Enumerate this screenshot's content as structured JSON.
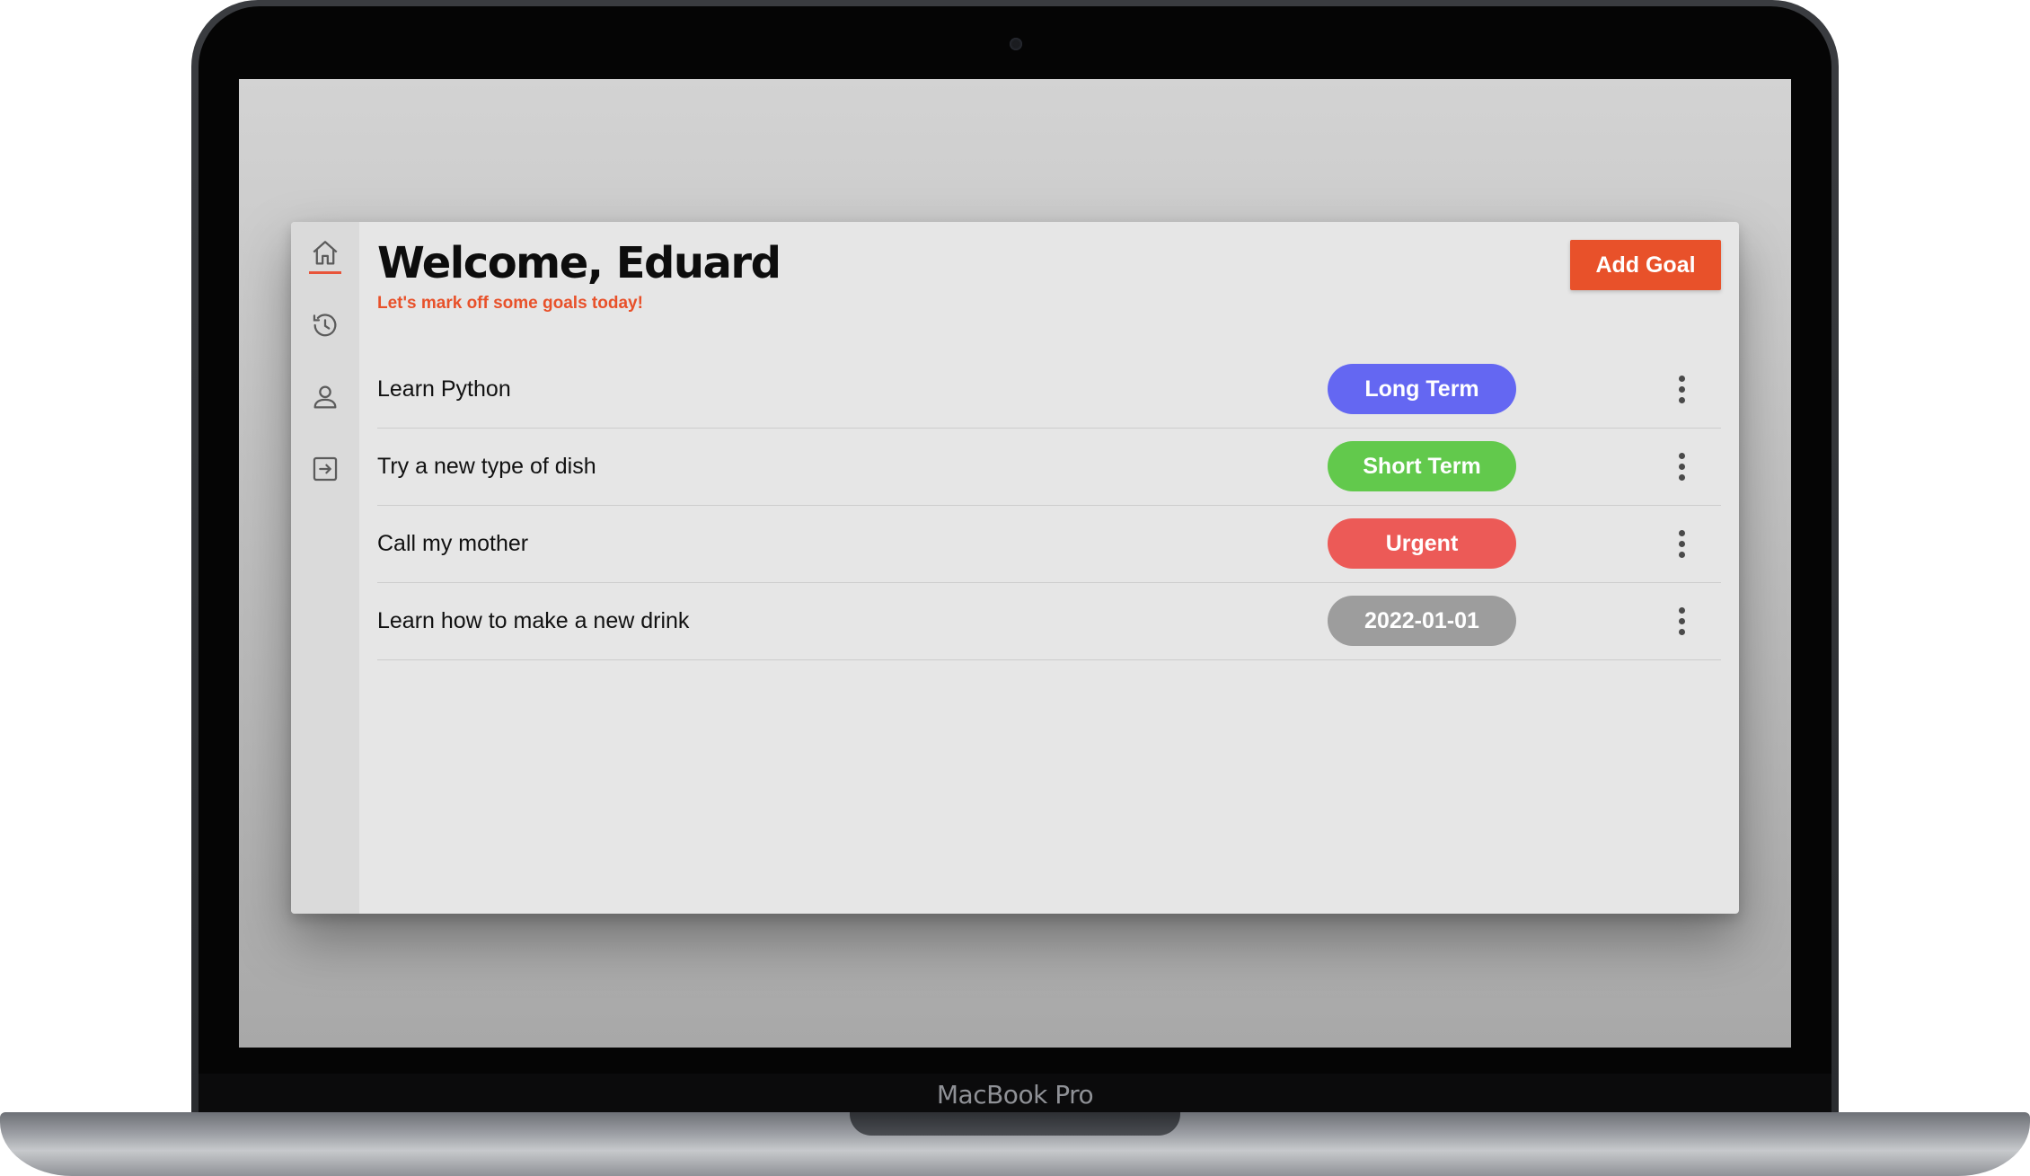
{
  "device": {
    "model_label": "MacBook Pro"
  },
  "sidebar": {
    "items": [
      {
        "name": "home",
        "icon": "home-icon",
        "active": true
      },
      {
        "name": "history",
        "icon": "history-icon",
        "active": false
      },
      {
        "name": "profile",
        "icon": "user-icon",
        "active": false
      },
      {
        "name": "logout",
        "icon": "logout-icon",
        "active": false
      }
    ],
    "active_color": "#e8543a"
  },
  "header": {
    "title": "Welcome, Eduard",
    "subtitle": "Let's mark off some goals today!",
    "add_button_label": "Add Goal"
  },
  "goals": [
    {
      "text": "Learn Python",
      "tag": "Long Term",
      "tag_color": "#6467f2"
    },
    {
      "text": "Try a new type of dish",
      "tag": "Short Term",
      "tag_color": "#62c94c"
    },
    {
      "text": "Call my mother",
      "tag": "Urgent",
      "tag_color": "#ec5a57"
    },
    {
      "text": "Learn how to make a new drink",
      "tag": "2022-01-01",
      "tag_color": "#9d9d9d"
    }
  ],
  "colors": {
    "accent": "#e8512a",
    "app_background": "#e6e6e6",
    "sidebar_background": "#dadada"
  }
}
